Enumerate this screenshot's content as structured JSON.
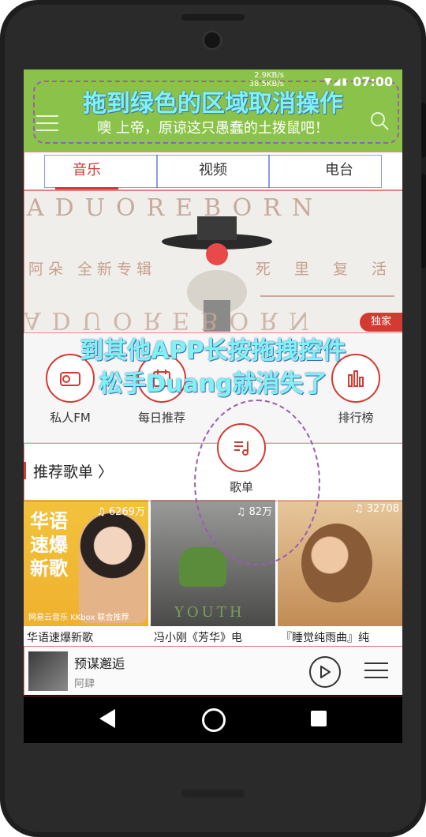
{
  "status_bar": {
    "net_speed_up": "2.9KB/s",
    "net_speed_down": "38.5KB/s",
    "icons": "▼◢▮",
    "time": "07:00"
  },
  "header": {
    "drop_zone_hint": "拖到绿色的区域取消操作",
    "subtitle": "噢 上帝，原谅这只愚蠢的土拨鼠吧！",
    "color": "#8bc34a"
  },
  "tabs": [
    {
      "label": "音乐"
    },
    {
      "label": "视频"
    },
    {
      "label": "电台"
    }
  ],
  "banner": {
    "top_text": "ADUOREBORN",
    "mid_left": "阿朵 全新专辑",
    "mid_right": "死 里 复 活",
    "bottom_text": "ADUOREBORN",
    "badge": "独家"
  },
  "drag_hint": {
    "line1": "到其他APP长按拖拽控件",
    "line2": "松手Duang就消失了"
  },
  "quick_actions": [
    {
      "label": "私人FM",
      "icon": "radio-icon"
    },
    {
      "label": "每日推荐",
      "icon": "calendar-icon"
    },
    {
      "label": "歌单",
      "icon": "playlist-icon"
    },
    {
      "label": "排行榜",
      "icon": "chart-icon"
    }
  ],
  "recommended": {
    "title": "推荐歌单 〉"
  },
  "playlists": [
    {
      "count": "6269万",
      "name": "华语速爆新歌",
      "cover_text": "华语\n速爆\n新歌",
      "brand": "网易云音乐 KKbox 联合推荐"
    },
    {
      "count": "82万",
      "name": "冯小刚《芳华》电",
      "cover_text": "YOUTH"
    },
    {
      "count": "32708",
      "name": "『睡觉纯雨曲』纯"
    }
  ],
  "player": {
    "song": "预谋邂逅",
    "artist": "阿肆"
  },
  "colors": {
    "accent": "#d33a31",
    "overlay_text": "#7ff3f3",
    "dashed": "#9b5db0"
  }
}
